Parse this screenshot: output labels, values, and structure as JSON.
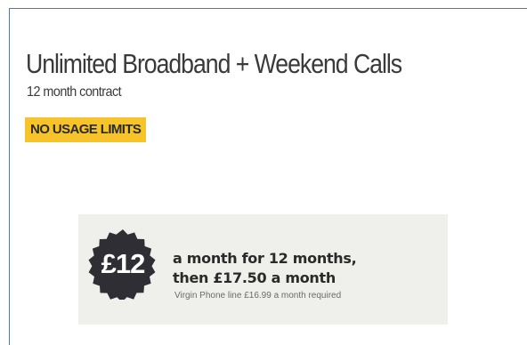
{
  "product": {
    "title": "Unlimited Broadband + Weekend Calls",
    "contract": "12 month contract",
    "badge": "NO USAGE LIMITS"
  },
  "offer": {
    "price": "£12",
    "line1": "a month for 12 months,",
    "line2": "then £17.50 a month",
    "note": "Virgin Phone line £16.99 a month required"
  },
  "colors": {
    "badge_bg": "#f7c32a",
    "price_circle": "#2e2e34",
    "card_border": "#5a7a90"
  }
}
